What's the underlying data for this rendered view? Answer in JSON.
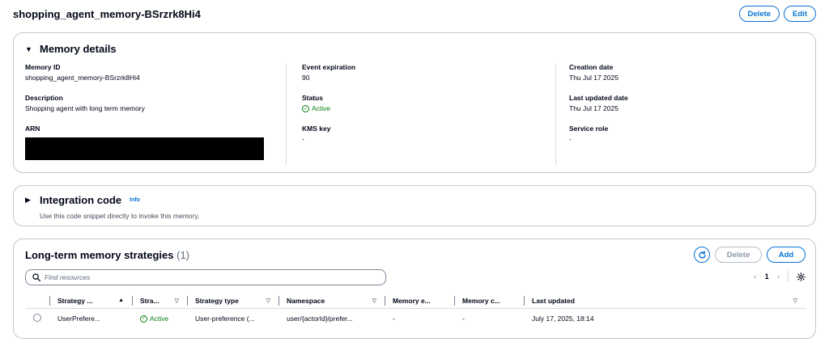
{
  "page": {
    "title": "shopping_agent_memory-BSrzrk8Hi4",
    "delete_label": "Delete",
    "edit_label": "Edit"
  },
  "details": {
    "title": "Memory details",
    "memory_id": {
      "label": "Memory ID",
      "value": "shopping_agent_memory-BSrzrk8Hi4"
    },
    "description": {
      "label": "Description",
      "value": "Shopping agent with long term memory"
    },
    "arn": {
      "label": "ARN",
      "value": ""
    },
    "event_expiration": {
      "label": "Event expiration",
      "value": "90"
    },
    "status": {
      "label": "Status",
      "value": "Active"
    },
    "kms_key": {
      "label": "KMS key",
      "value": "-"
    },
    "creation_date": {
      "label": "Creation date",
      "value": "Thu Jul 17 2025"
    },
    "last_updated_date": {
      "label": "Last updated date",
      "value": "Thu Jul 17 2025"
    },
    "service_role": {
      "label": "Service role",
      "value": "-"
    }
  },
  "integration": {
    "title": "Integration code",
    "info_label": "Info",
    "description": "Use this code snippet directly to invoke this memory."
  },
  "strategies": {
    "title": "Long-term memory strategies",
    "count": "(1)",
    "delete_label": "Delete",
    "add_label": "Add",
    "search_placeholder": "Find resources",
    "page_number": "1",
    "columns": [
      "Strategy ...",
      "Stra...",
      "Strategy type",
      "Namespace",
      "Memory e...",
      "Memory c...",
      "Last updated"
    ],
    "rows": [
      {
        "name": "UserPrefere...",
        "status": "Active",
        "type": "User-preference (...",
        "namespace": "user/{actorId}/prefer...",
        "memory_e": "-",
        "memory_c": "-",
        "last_updated": "July 17, 2025, 18:14"
      }
    ]
  },
  "colors": {
    "accent": "#0972d3",
    "success": "#037f0c",
    "border": "#c6c6cd"
  }
}
